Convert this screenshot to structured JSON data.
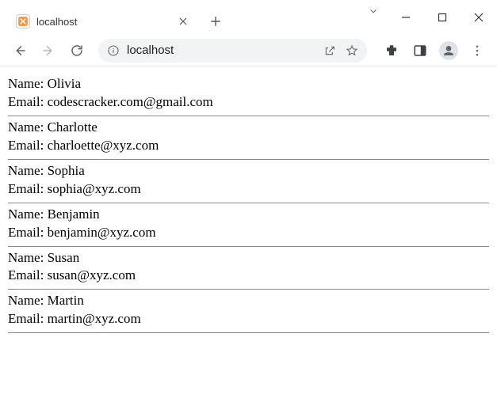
{
  "tab": {
    "title": "localhost"
  },
  "address": {
    "url_text": "localhost"
  },
  "labels": {
    "name": "Name:",
    "email": "Email:"
  },
  "entries": [
    {
      "name": "Olivia",
      "email": "codescracker.com@gmail.com"
    },
    {
      "name": "Charlotte",
      "email": "charloette@xyz.com"
    },
    {
      "name": "Sophia",
      "email": "sophia@xyz.com"
    },
    {
      "name": "Benjamin",
      "email": "benjamin@xyz.com"
    },
    {
      "name": "Susan",
      "email": "susan@xyz.com"
    },
    {
      "name": "Martin",
      "email": "martin@xyz.com"
    }
  ]
}
